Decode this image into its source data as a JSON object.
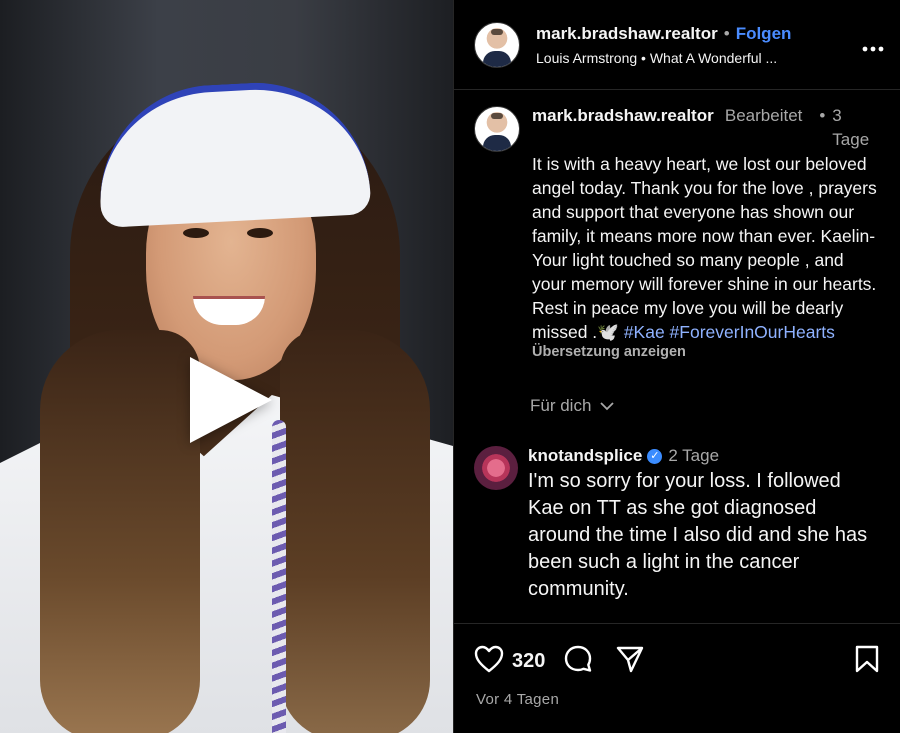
{
  "header": {
    "username": "mark.bradshaw.realtor",
    "separator": "•",
    "follow_label": "Folgen",
    "audio": "Louis Armstrong • What A Wonderful ...",
    "more_icon": "more-icon"
  },
  "post": {
    "username": "mark.bradshaw.realtor",
    "edited": "Bearbeitet",
    "separator": "•",
    "time_ago": "3 Tage",
    "caption": "It is with a heavy heart, we lost our beloved angel today. Thank you for the love , prayers and support that everyone has shown our family, it means more now than ever.  Kaelin- Your light touched so many people , and your memory will forever shine in our hearts. Rest in peace my love you will be dearly missed .🕊️",
    "hashtags": "#Kae #ForeverInOurHearts",
    "translate_label": "Übersetzung anzeigen",
    "for_you_label": "Für dich"
  },
  "comment": {
    "username": "knotandsplice",
    "time_ago": "2 Tage",
    "text": "I'm so sorry for your loss. I followed Kae on TT as she got diagnosed around the time I also did and she has been such a light in the cancer community."
  },
  "actions": {
    "likes": "320",
    "posted": "Vor 4 Tagen"
  },
  "colors": {
    "accent": "#4a8cff",
    "hashtag": "#8fb2ff",
    "muted": "#a8a8a8",
    "background": "#000000"
  }
}
